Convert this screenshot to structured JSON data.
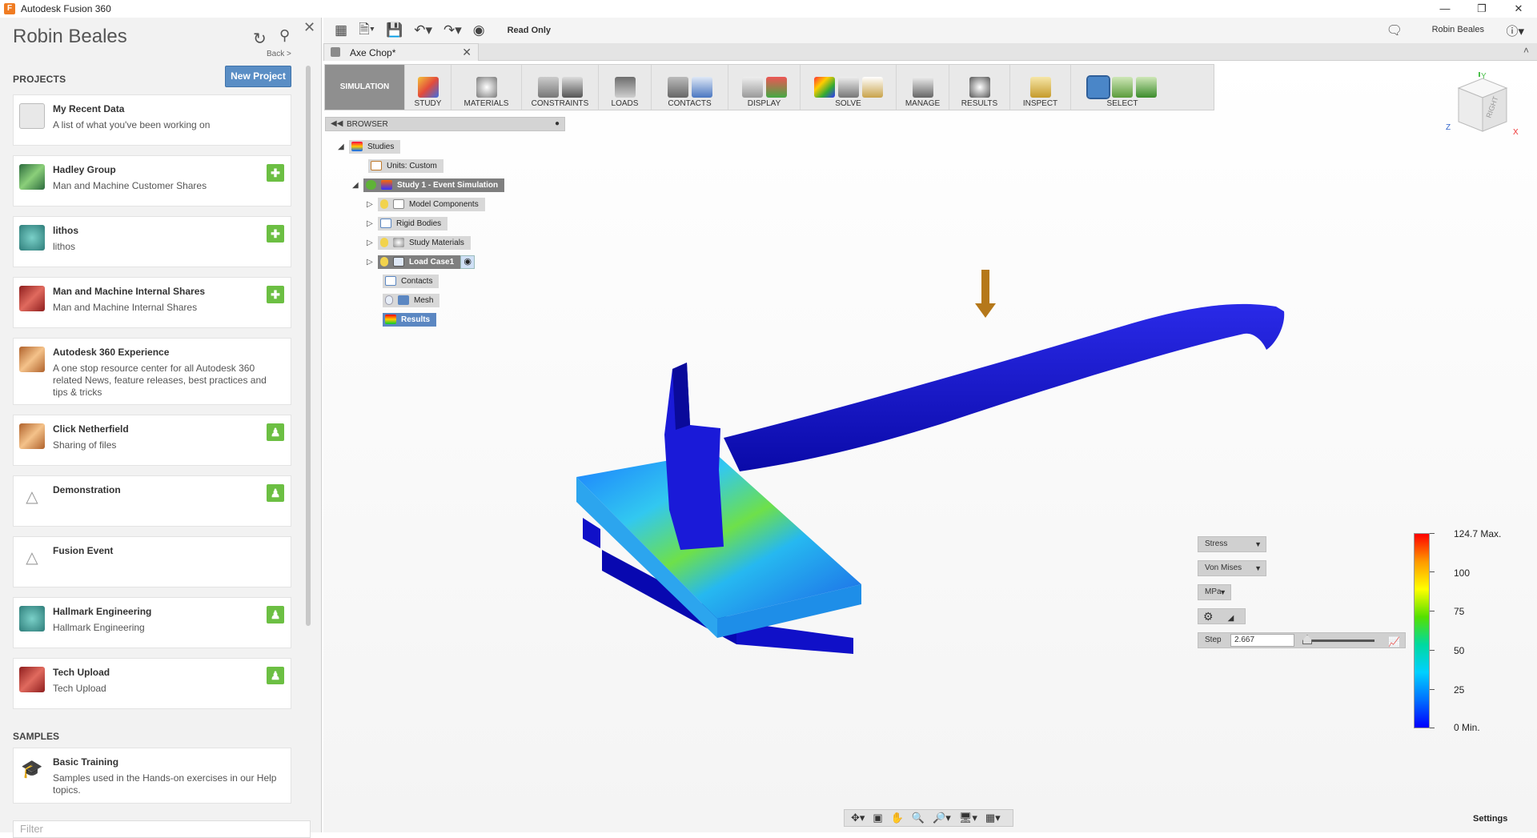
{
  "window": {
    "title": "Autodesk Fusion 360",
    "app_icon": "F"
  },
  "data_panel": {
    "user_name": "Robin Beales",
    "back_label": "Back >",
    "projects_label": "PROJECTS",
    "new_project_label": "New Project",
    "projects": [
      {
        "name": "My Recent Data",
        "desc": "A list of what you've been working on",
        "thumb": "recent-data-icon",
        "badge": ""
      },
      {
        "name": "Hadley Group",
        "desc": "Man and Machine Customer Shares",
        "thumb": "project-thumbnail-green",
        "badge": "shared"
      },
      {
        "name": "lithos",
        "desc": "lithos",
        "thumb": "project-thumbnail-teal",
        "badge": "shared"
      },
      {
        "name": "Man and Machine Internal Shares",
        "desc": "Man and Machine Internal Shares",
        "thumb": "project-thumbnail-red",
        "badge": "shared"
      },
      {
        "name": "Autodesk 360 Experience",
        "desc": "A one stop resource center for all Autodesk 360 related News, feature releases, best practices and tips & tricks",
        "thumb": "project-thumbnail-orange",
        "badge": ""
      },
      {
        "name": "Click Netherfield",
        "desc": "Sharing of files",
        "thumb": "project-thumbnail-orange",
        "badge": "user"
      },
      {
        "name": "Demonstration",
        "desc": "",
        "thumb": "project-default-icon",
        "badge": "user"
      },
      {
        "name": "Fusion Event",
        "desc": "",
        "thumb": "project-default-icon",
        "badge": ""
      },
      {
        "name": "Hallmark Engineering",
        "desc": "Hallmark Engineering",
        "thumb": "project-thumbnail-teal",
        "badge": "user"
      },
      {
        "name": "Tech Upload",
        "desc": "Tech Upload",
        "thumb": "project-thumbnail-red",
        "badge": "user"
      }
    ],
    "samples_label": "SAMPLES",
    "sample": {
      "name": "Basic Training",
      "desc": "Samples used in the Hands-on exercises in our Help topics."
    },
    "filter_placeholder": "Filter"
  },
  "toolbar": {
    "read_only": "Read Only",
    "user": "Robin Beales"
  },
  "document_tab": {
    "name": "Axe Chop*"
  },
  "ribbon": {
    "workspace": "SIMULATION",
    "groups": [
      "STUDY",
      "MATERIALS",
      "CONSTRAINTS",
      "LOADS",
      "CONTACTS",
      "DISPLAY",
      "SOLVE",
      "MANAGE",
      "RESULTS",
      "INSPECT",
      "SELECT"
    ]
  },
  "browser": {
    "title": "BROWSER",
    "nodes": {
      "studies": "Studies",
      "units": "Units: Custom",
      "study1": "Study 1 - Event Simulation",
      "model_components": "Model Components",
      "rigid_bodies": "Rigid Bodies",
      "study_materials": "Study Materials",
      "load_case": "Load Case1",
      "contacts": "Contacts",
      "mesh": "Mesh",
      "results": "Results"
    }
  },
  "result_panel": {
    "result_type": "Stress",
    "component": "Von Mises",
    "units": "MPa",
    "step_label": "Step",
    "step_value": "2.667",
    "legend": {
      "max": "124.7 Max.",
      "t100": "100",
      "t75": "75",
      "t50": "50",
      "t25": "25",
      "min": "0 Min."
    }
  },
  "viewcube": {
    "face": "RIGHT",
    "axes": {
      "x": "X",
      "y": "Y",
      "z": "Z"
    }
  },
  "status": {
    "settings": "Settings"
  },
  "colors": {
    "accent": "#5a8ec5",
    "badge": "#6cbf43",
    "ribbon_workspace": "#8f8f8f",
    "axe_handle": "#1a1acc",
    "load_arrow": "#b5781a"
  }
}
